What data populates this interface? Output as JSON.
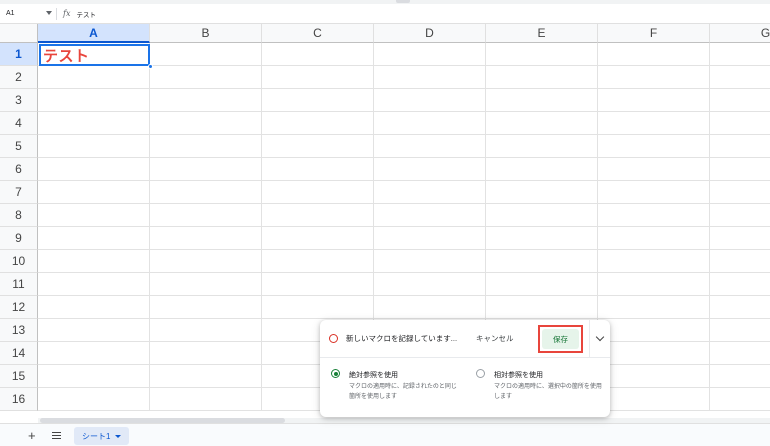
{
  "formula_bar": {
    "cell_ref": "A1",
    "fx": "fx",
    "formula": "テスト"
  },
  "grid": {
    "columns": [
      "A",
      "B",
      "C",
      "D",
      "E",
      "F",
      "G"
    ],
    "rows": [
      "1",
      "2",
      "3",
      "4",
      "5",
      "6",
      "7",
      "8",
      "9",
      "10",
      "11",
      "12",
      "13",
      "14",
      "15",
      "16"
    ],
    "selected_cell": "A1",
    "a1_value": "テスト",
    "a1_color": "#e8453c"
  },
  "sheet_tabs": {
    "add": "+",
    "active_sheet": "シート1"
  },
  "macro_panel": {
    "status": "新しいマクロを記録しています...",
    "cancel_label": "キャンセル",
    "save_label": "保存",
    "options": [
      {
        "title": "絶対参照を使用",
        "description": "マクロの適用時に、記録されたのと同じ箇所を使用します",
        "selected": true
      },
      {
        "title": "相対参照を使用",
        "description": "マクロの適用時に、選択中の箇所を使用します",
        "selected": false
      }
    ],
    "highlight_color": "#e8453c"
  },
  "colors": {
    "accent": "#1a73e8",
    "record": "#d93025",
    "save_green": "#137333"
  }
}
